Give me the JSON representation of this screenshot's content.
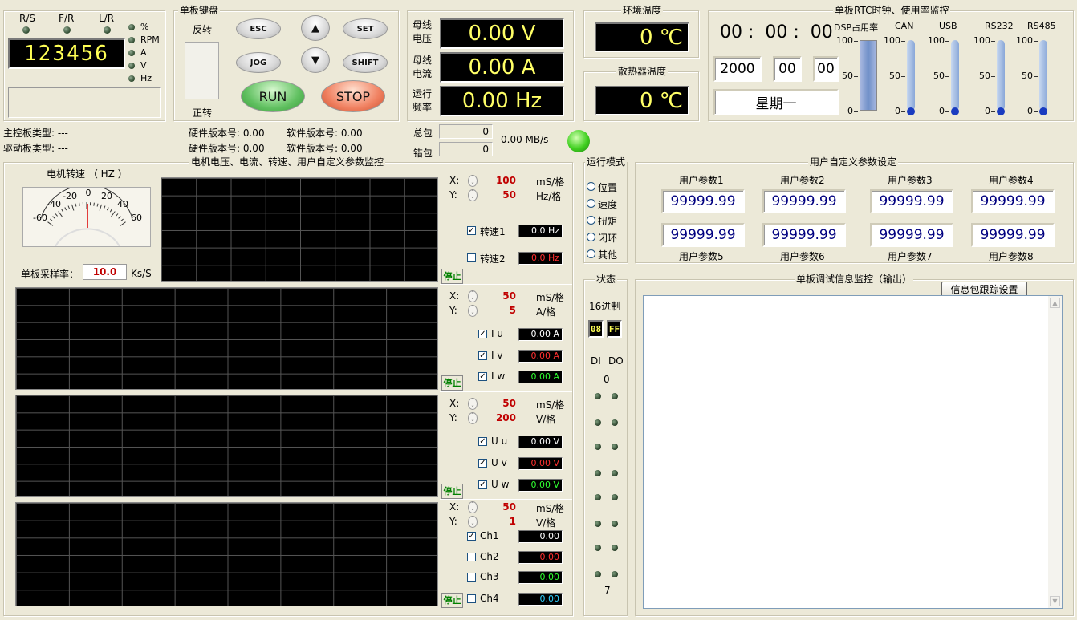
{
  "leds": {
    "rs": "R/S",
    "fr": "F/R",
    "lr": "L/R",
    "units": [
      "%",
      "RPM",
      "A",
      "V",
      "Hz"
    ],
    "display": "123456"
  },
  "keypad": {
    "title": "单板键盘",
    "reverse": "反转",
    "forward": "正转",
    "esc": "ESC",
    "jog": "JOG",
    "set": "SET",
    "shift": "SHIFT",
    "run": "RUN",
    "stop": "STOP",
    "up": "▲",
    "down": "▼"
  },
  "bus": {
    "voltage_label": "母线电压",
    "voltage": "0.00  V",
    "current_label": "母线电流",
    "current": "0.00  A",
    "freq_label": "运行频率",
    "freq": "0.00 Hz"
  },
  "temps": {
    "env_title": "环境温度",
    "env": "0 ℃",
    "sink_title": "散热器温度",
    "sink": "0 ℃"
  },
  "rtc": {
    "title": "单板RTC时钟、使用率监控",
    "time": "00 :  00 :  00",
    "year": "2000",
    "month": "00",
    "day": "00",
    "weekday": "星期一",
    "gauges": [
      {
        "name": "DSP占用率",
        "level": 100
      },
      {
        "name": "CAN",
        "level": 0
      },
      {
        "name": "USB",
        "level": 0
      },
      {
        "name": "RS232",
        "level": 0
      },
      {
        "name": "RS485",
        "level": 0
      }
    ],
    "ticks": [
      "100",
      "50",
      "0"
    ]
  },
  "info": {
    "main_type": "主控板类型: ---",
    "drive_type": "驱动板类型: ---",
    "hw1": "硬件版本号: 0.00",
    "sw1": "软件版本号: 0.00",
    "hw2": "硬件版本号: 0.00",
    "sw2": "软件版本号: 0.00",
    "total_label": "总包",
    "total": "0",
    "err_label": "错包",
    "err": "0",
    "rate": "0.00 MB/s"
  },
  "monitor": {
    "title": "电机电压、电流、转速、用户自定义参数监控",
    "speed_title": "电机转速 （ HZ ）",
    "gauge_ticks": [
      "-60",
      "-40",
      "-20",
      "0",
      "20",
      "40",
      "60"
    ],
    "sample_label": "单板采样率：",
    "sample": "10.0",
    "sample_unit": "Ks/S",
    "stop": "停止",
    "scopes": [
      {
        "x": "100",
        "xu": "mS/格",
        "y": "50",
        "yu": "Hz/格",
        "ch": [
          {
            "n": "转速1",
            "v": "0.0 Hz",
            "c": "#ffffff",
            "on": true
          },
          {
            "n": "转速2",
            "v": "0.0 Hz",
            "c": "#ff3030",
            "on": false
          }
        ]
      },
      {
        "x": "50",
        "xu": "mS/格",
        "y": "5",
        "yu": "A/格",
        "ch": [
          {
            "n": "I u",
            "v": "0.00 A",
            "c": "#ffffff",
            "on": true
          },
          {
            "n": "I v",
            "v": "0.00 A",
            "c": "#ff3030",
            "on": true
          },
          {
            "n": "I w",
            "v": "0.00 A",
            "c": "#30ff30",
            "on": true
          }
        ]
      },
      {
        "x": "50",
        "xu": "mS/格",
        "y": "200",
        "yu": "V/格",
        "ch": [
          {
            "n": "U u",
            "v": "0.00 V",
            "c": "#ffffff",
            "on": true
          },
          {
            "n": "U v",
            "v": "0.00 V",
            "c": "#ff3030",
            "on": true
          },
          {
            "n": "U w",
            "v": "0.00 V",
            "c": "#30ff30",
            "on": true
          }
        ]
      },
      {
        "x": "50",
        "xu": "mS/格",
        "y": "1",
        "yu": "V/格",
        "ch": [
          {
            "n": "Ch1",
            "v": "0.00",
            "c": "#ffffff",
            "on": true
          },
          {
            "n": "Ch2",
            "v": "0.00",
            "c": "#ff3030",
            "on": false
          },
          {
            "n": "Ch3",
            "v": "0.00",
            "c": "#30ff30",
            "on": false
          },
          {
            "n": "Ch4",
            "v": "0.00",
            "c": "#30d0ff",
            "on": false
          }
        ]
      }
    ]
  },
  "mode": {
    "title": "运行模式",
    "options": [
      "位置",
      "速度",
      "扭矩",
      "闭环",
      "其他"
    ]
  },
  "userparams": {
    "title": "用户自定义参数设定",
    "labels_top": [
      "用户参数1",
      "用户参数2",
      "用户参数3",
      "用户参数4"
    ],
    "values_top": [
      "99999.99",
      "99999.99",
      "99999.99",
      "99999.99"
    ],
    "labels_bottom": [
      "用户参数5",
      "用户参数6",
      "用户参数7",
      "用户参数8"
    ],
    "values_bottom": [
      "99999.99",
      "99999.99",
      "99999.99",
      "99999.99"
    ]
  },
  "status": {
    "title": "状态",
    "hex_label": "16进制",
    "hex1": "08",
    "hex2": "FF",
    "di": "DI",
    "do": "DO",
    "first": "0",
    "last": "7"
  },
  "debug": {
    "title": "单板调试信息监控（输出）",
    "button": "信息包跟踪设置"
  }
}
